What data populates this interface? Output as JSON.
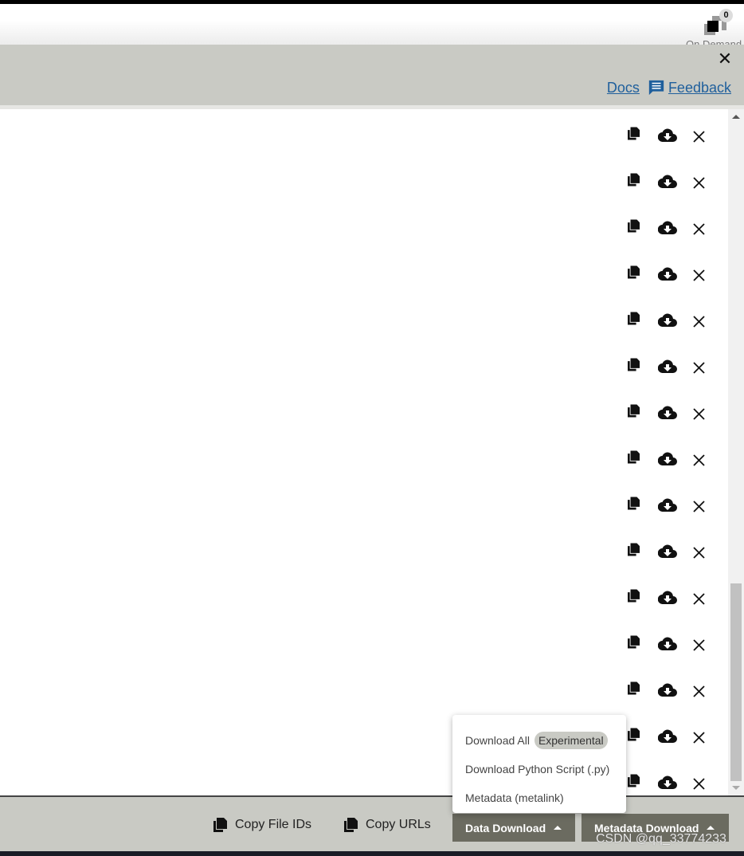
{
  "header": {
    "on_demand_label": "On Demand",
    "on_demand_count": "0"
  },
  "panel": {
    "docs_label": "Docs",
    "feedback_label": "Feedback",
    "close_icon": "close-icon"
  },
  "list": {
    "row_count": 15,
    "row_actions": [
      "copy-icon",
      "cloud-download-icon",
      "remove-icon"
    ]
  },
  "footer": {
    "copy_file_ids": "Copy File IDs",
    "copy_urls": "Copy URLs",
    "data_download": "Data Download",
    "metadata_download": "Metadata Download"
  },
  "menu": {
    "items": [
      {
        "label": "Download All",
        "badge": "Experimental"
      },
      {
        "label": "Download Python Script (.py)"
      },
      {
        "label": "Metadata (metalink)"
      }
    ]
  },
  "watermark": "CSDN @qq_33774233",
  "colors": {
    "panel": "#c9cac4",
    "button": "#6b6b60",
    "link": "#1f5f9c"
  }
}
